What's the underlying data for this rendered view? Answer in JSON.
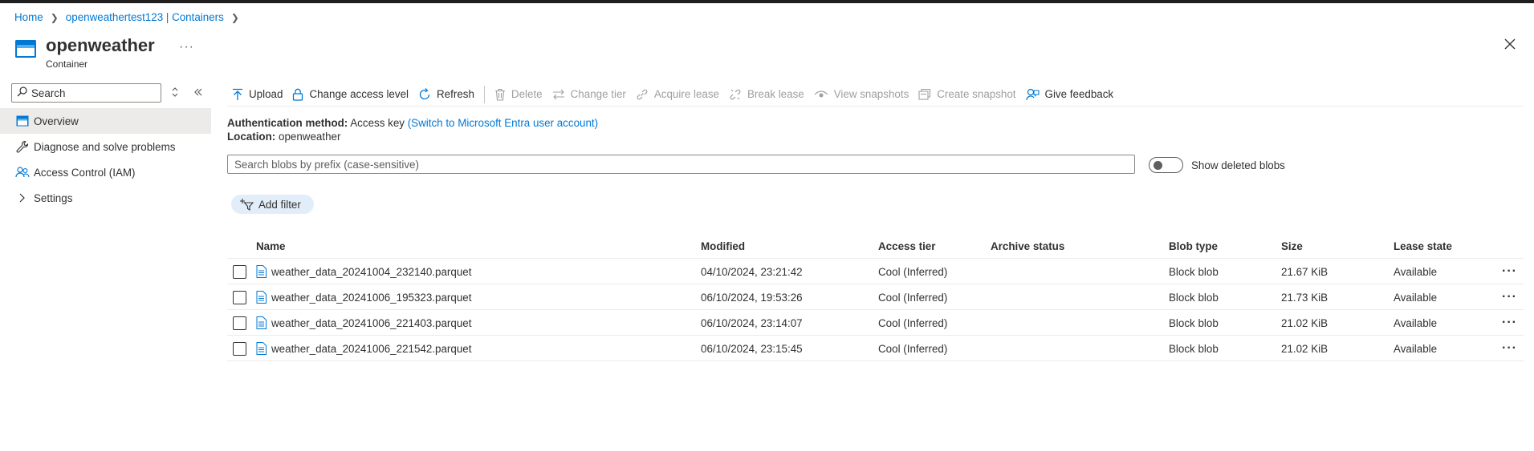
{
  "breadcrumb": {
    "home": "Home",
    "storage": "openweathertest123 | Containers"
  },
  "header": {
    "title": "openweather",
    "subtitle": "Container",
    "more": "···"
  },
  "sidebar": {
    "search_placeholder": "Search",
    "items": [
      {
        "label": "Overview",
        "icon": "overview-icon",
        "active": true
      },
      {
        "label": "Diagnose and solve problems",
        "icon": "wrench-icon"
      },
      {
        "label": "Access Control (IAM)",
        "icon": "people-icon"
      },
      {
        "label": "Settings",
        "icon": "chevron-right-icon"
      }
    ]
  },
  "toolbar": {
    "upload": "Upload",
    "change_access": "Change access level",
    "refresh": "Refresh",
    "delete": "Delete",
    "change_tier": "Change tier",
    "acquire_lease": "Acquire lease",
    "break_lease": "Break lease",
    "view_snapshots": "View snapshots",
    "create_snapshot": "Create snapshot",
    "give_feedback": "Give feedback"
  },
  "info": {
    "auth_label": "Authentication method:",
    "auth_value": "Access key",
    "auth_link": "(Switch to Microsoft Entra user account)",
    "location_label": "Location:",
    "location_value": "openweather"
  },
  "filter": {
    "search_placeholder": "Search blobs by prefix (case-sensitive)",
    "show_deleted": "Show deleted blobs",
    "show_deleted_on": false,
    "add_filter": "Add filter"
  },
  "table": {
    "headers": {
      "name": "Name",
      "modified": "Modified",
      "access_tier": "Access tier",
      "archive_status": "Archive status",
      "blob_type": "Blob type",
      "size": "Size",
      "lease_state": "Lease state"
    },
    "rows": [
      {
        "name": "weather_data_20241004_232140.parquet",
        "modified": "04/10/2024, 23:21:42",
        "access_tier": "Cool (Inferred)",
        "archive_status": "",
        "blob_type": "Block blob",
        "size": "21.67 KiB",
        "lease_state": "Available"
      },
      {
        "name": "weather_data_20241006_195323.parquet",
        "modified": "06/10/2024, 19:53:26",
        "access_tier": "Cool (Inferred)",
        "archive_status": "",
        "blob_type": "Block blob",
        "size": "21.73 KiB",
        "lease_state": "Available"
      },
      {
        "name": "weather_data_20241006_221403.parquet",
        "modified": "06/10/2024, 23:14:07",
        "access_tier": "Cool (Inferred)",
        "archive_status": "",
        "blob_type": "Block blob",
        "size": "21.02 KiB",
        "lease_state": "Available"
      },
      {
        "name": "weather_data_20241006_221542.parquet",
        "modified": "06/10/2024, 23:15:45",
        "access_tier": "Cool (Inferred)",
        "archive_status": "",
        "blob_type": "Block blob",
        "size": "21.02 KiB",
        "lease_state": "Available"
      }
    ],
    "row_more": "···"
  },
  "colors": {
    "accent": "#0078d4",
    "disabled": "#a19f9d",
    "selected_bg": "#edebe9",
    "filter_pill_bg": "#e1eefa"
  }
}
